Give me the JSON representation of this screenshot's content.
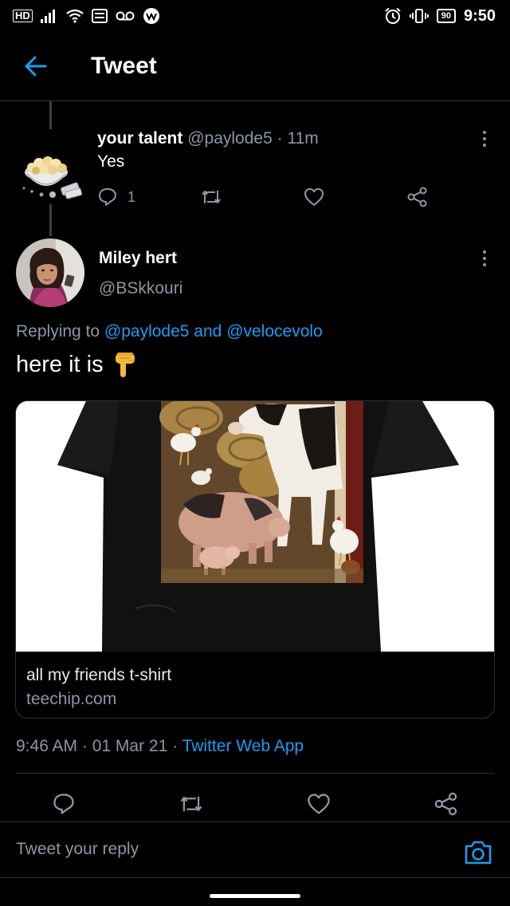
{
  "status_bar": {
    "hd_label": "HD",
    "battery": "90",
    "time": "9:50"
  },
  "header": {
    "title": "Tweet"
  },
  "parent_tweet": {
    "display_name": "your talent",
    "handle": "@paylode5",
    "separator": "·",
    "time_ago": "11m",
    "text": "Yes",
    "reply_count": "1"
  },
  "main_tweet": {
    "display_name": "Miley hert",
    "handle": "@BSkkouri",
    "replying_prefix": "Replying to ",
    "replying_user1": "@paylode5",
    "replying_and": " and ",
    "replying_user2": "@velocevolo",
    "text": "here it is",
    "emoji": "👇",
    "card": {
      "title": "all my friends t-shirt",
      "domain": "teechip.com"
    },
    "time": "9:46 AM",
    "dot1": " · ",
    "date": "01 Mar 21",
    "dot2": " · ",
    "source": "Twitter Web App"
  },
  "reply_bar": {
    "placeholder": "Tweet your reply"
  },
  "colors": {
    "background": "#000000",
    "accent": "#1d9bf0",
    "muted": "#8b98a5",
    "divider": "#2f3336"
  }
}
